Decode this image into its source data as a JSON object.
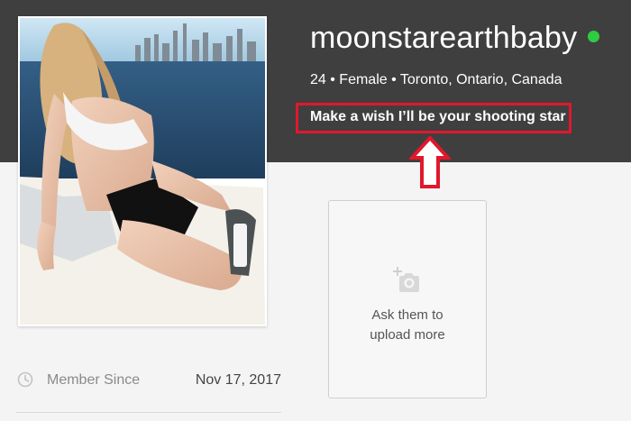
{
  "profile": {
    "username": "moonstarearthbaby",
    "online_status": "online",
    "meta": "24 • Female • Toronto, Ontario, Canada",
    "tagline": "Make a wish I’ll be your shooting star"
  },
  "upload_card": {
    "line1": "Ask them to",
    "line2": "upload more",
    "icon": "add-photo-icon"
  },
  "member_since": {
    "label": "Member Since",
    "date": "Nov 17, 2017",
    "icon": "clock-icon"
  },
  "colors": {
    "header_bg": "#3f3f3f",
    "highlight_red": "#e0182d",
    "online_green": "#2ecc40"
  }
}
